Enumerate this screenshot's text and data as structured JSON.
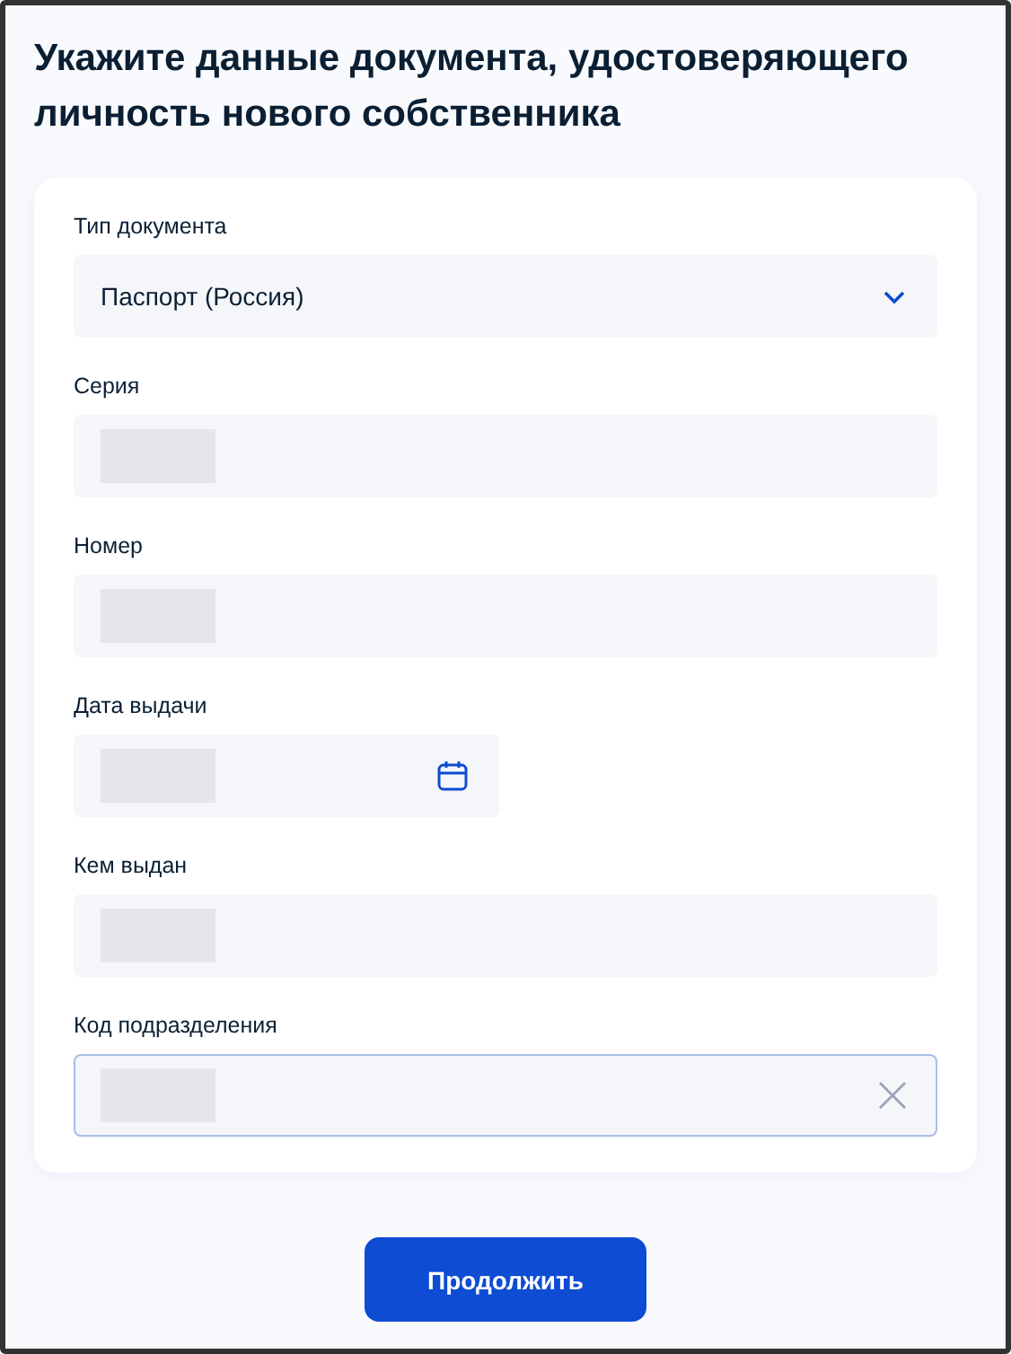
{
  "title": "Укажите данные документа, удостоверяющего личность нового собственника",
  "fields": [
    {
      "kind": "select",
      "label": "Тип документа",
      "value": "Паспорт (Россия)",
      "focused": false
    },
    {
      "kind": "text",
      "label": "Серия",
      "redacted": true,
      "focused": false
    },
    {
      "kind": "text",
      "label": "Номер",
      "redacted": true,
      "focused": false
    },
    {
      "kind": "date",
      "label": "Дата выдачи",
      "redacted": true,
      "focused": false
    },
    {
      "kind": "text",
      "label": "Кем выдан",
      "redacted": true,
      "focused": false
    },
    {
      "kind": "clearable",
      "label": "Код подразделения",
      "redacted": true,
      "focused": true
    }
  ],
  "button": "Продолжить"
}
